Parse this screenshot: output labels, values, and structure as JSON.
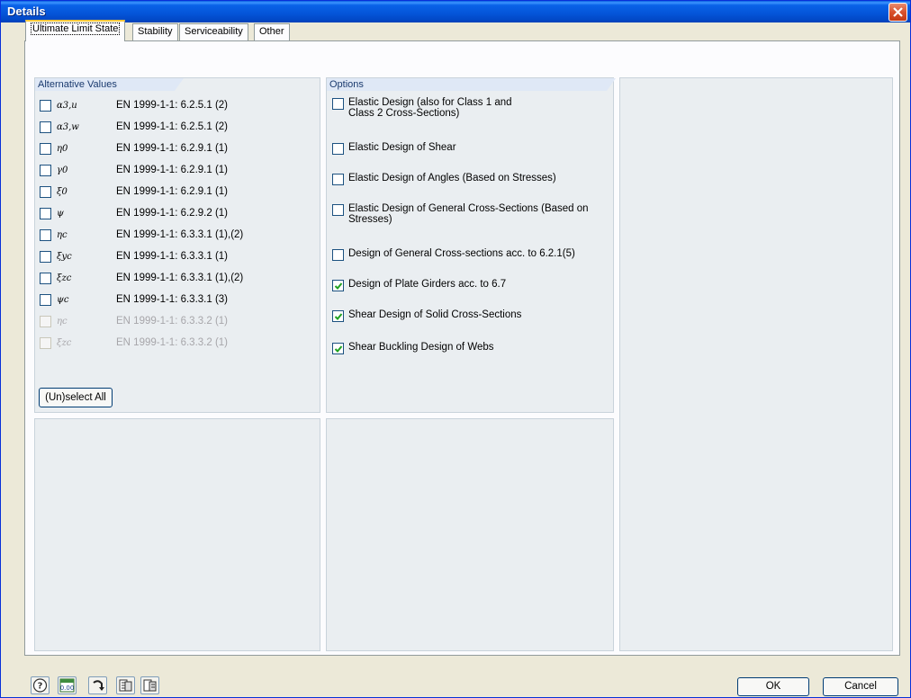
{
  "window": {
    "title": "Details"
  },
  "tabs": [
    {
      "label": "Ultimate Limit State",
      "active": true
    },
    {
      "label": "Stability"
    },
    {
      "label": "Serviceability"
    },
    {
      "label": "Other"
    }
  ],
  "alt_values": {
    "header": "Alternative Values",
    "items": [
      {
        "symbol": "α3,u",
        "ref": "EN 1999-1-1: 6.2.5.1 (2)",
        "checked": false,
        "disabled": false
      },
      {
        "symbol": "α3,w",
        "ref": "EN 1999-1-1: 6.2.5.1 (2)",
        "checked": false,
        "disabled": false
      },
      {
        "symbol": "η0",
        "ref": "EN 1999-1-1: 6.2.9.1 (1)",
        "checked": false,
        "disabled": false
      },
      {
        "symbol": "γ0",
        "ref": "EN 1999-1-1: 6.2.9.1 (1)",
        "checked": false,
        "disabled": false
      },
      {
        "symbol": "ξ0",
        "ref": "EN 1999-1-1: 6.2.9.1 (1)",
        "checked": false,
        "disabled": false
      },
      {
        "symbol": "ψ",
        "ref": "EN 1999-1-1: 6.2.9.2 (1)",
        "checked": false,
        "disabled": false
      },
      {
        "symbol": "ηc",
        "ref": "EN 1999-1-1: 6.3.3.1 (1),(2)",
        "checked": false,
        "disabled": false
      },
      {
        "symbol": "ξyc",
        "ref": "EN 1999-1-1: 6.3.3.1 (1)",
        "checked": false,
        "disabled": false
      },
      {
        "symbol": "ξzc",
        "ref": "EN 1999-1-1: 6.3.3.1 (1),(2)",
        "checked": false,
        "disabled": false
      },
      {
        "symbol": "ψc",
        "ref": "EN 1999-1-1: 6.3.3.1 (3)",
        "checked": false,
        "disabled": false
      },
      {
        "symbol": "ηc",
        "ref": "EN 1999-1-1: 6.3.3.2 (1)",
        "checked": false,
        "disabled": true
      },
      {
        "symbol": "ξzc",
        "ref": "EN 1999-1-1: 6.3.3.2 (1)",
        "checked": false,
        "disabled": true
      }
    ],
    "unselect_label": "(Un)select All"
  },
  "options": {
    "header": "Options",
    "items": [
      {
        "line1": "Elastic Design (also for Class 1 and",
        "line2": "Class 2 Cross-Sections)",
        "checked": false
      },
      {
        "line1": "Elastic Design of Shear",
        "line2": "",
        "checked": false
      },
      {
        "line1": "Elastic Design of Angles (Based on Stresses)",
        "line2": "",
        "checked": false
      },
      {
        "line1": "Elastic Design of General Cross-Sections (Based on",
        "line2": "Stresses)",
        "checked": false
      },
      {
        "line1": "Design of General Cross-sections acc. to 6.2.1(5)",
        "line2": "",
        "checked": false
      },
      {
        "line1": "Design of Plate Girders acc. to 6.7",
        "line2": "",
        "checked": true
      },
      {
        "line1": "Shear Design of Solid Cross-Sections",
        "line2": "",
        "checked": true
      },
      {
        "line1": "Shear Buckling Design of Webs",
        "line2": "",
        "checked": true
      }
    ]
  },
  "footer": {
    "tool_icons": [
      "help-icon",
      "number-format-icon",
      "reset-default-icon",
      "export-icon",
      "import-icon"
    ],
    "ok_label": "OK",
    "cancel_label": "Cancel"
  }
}
